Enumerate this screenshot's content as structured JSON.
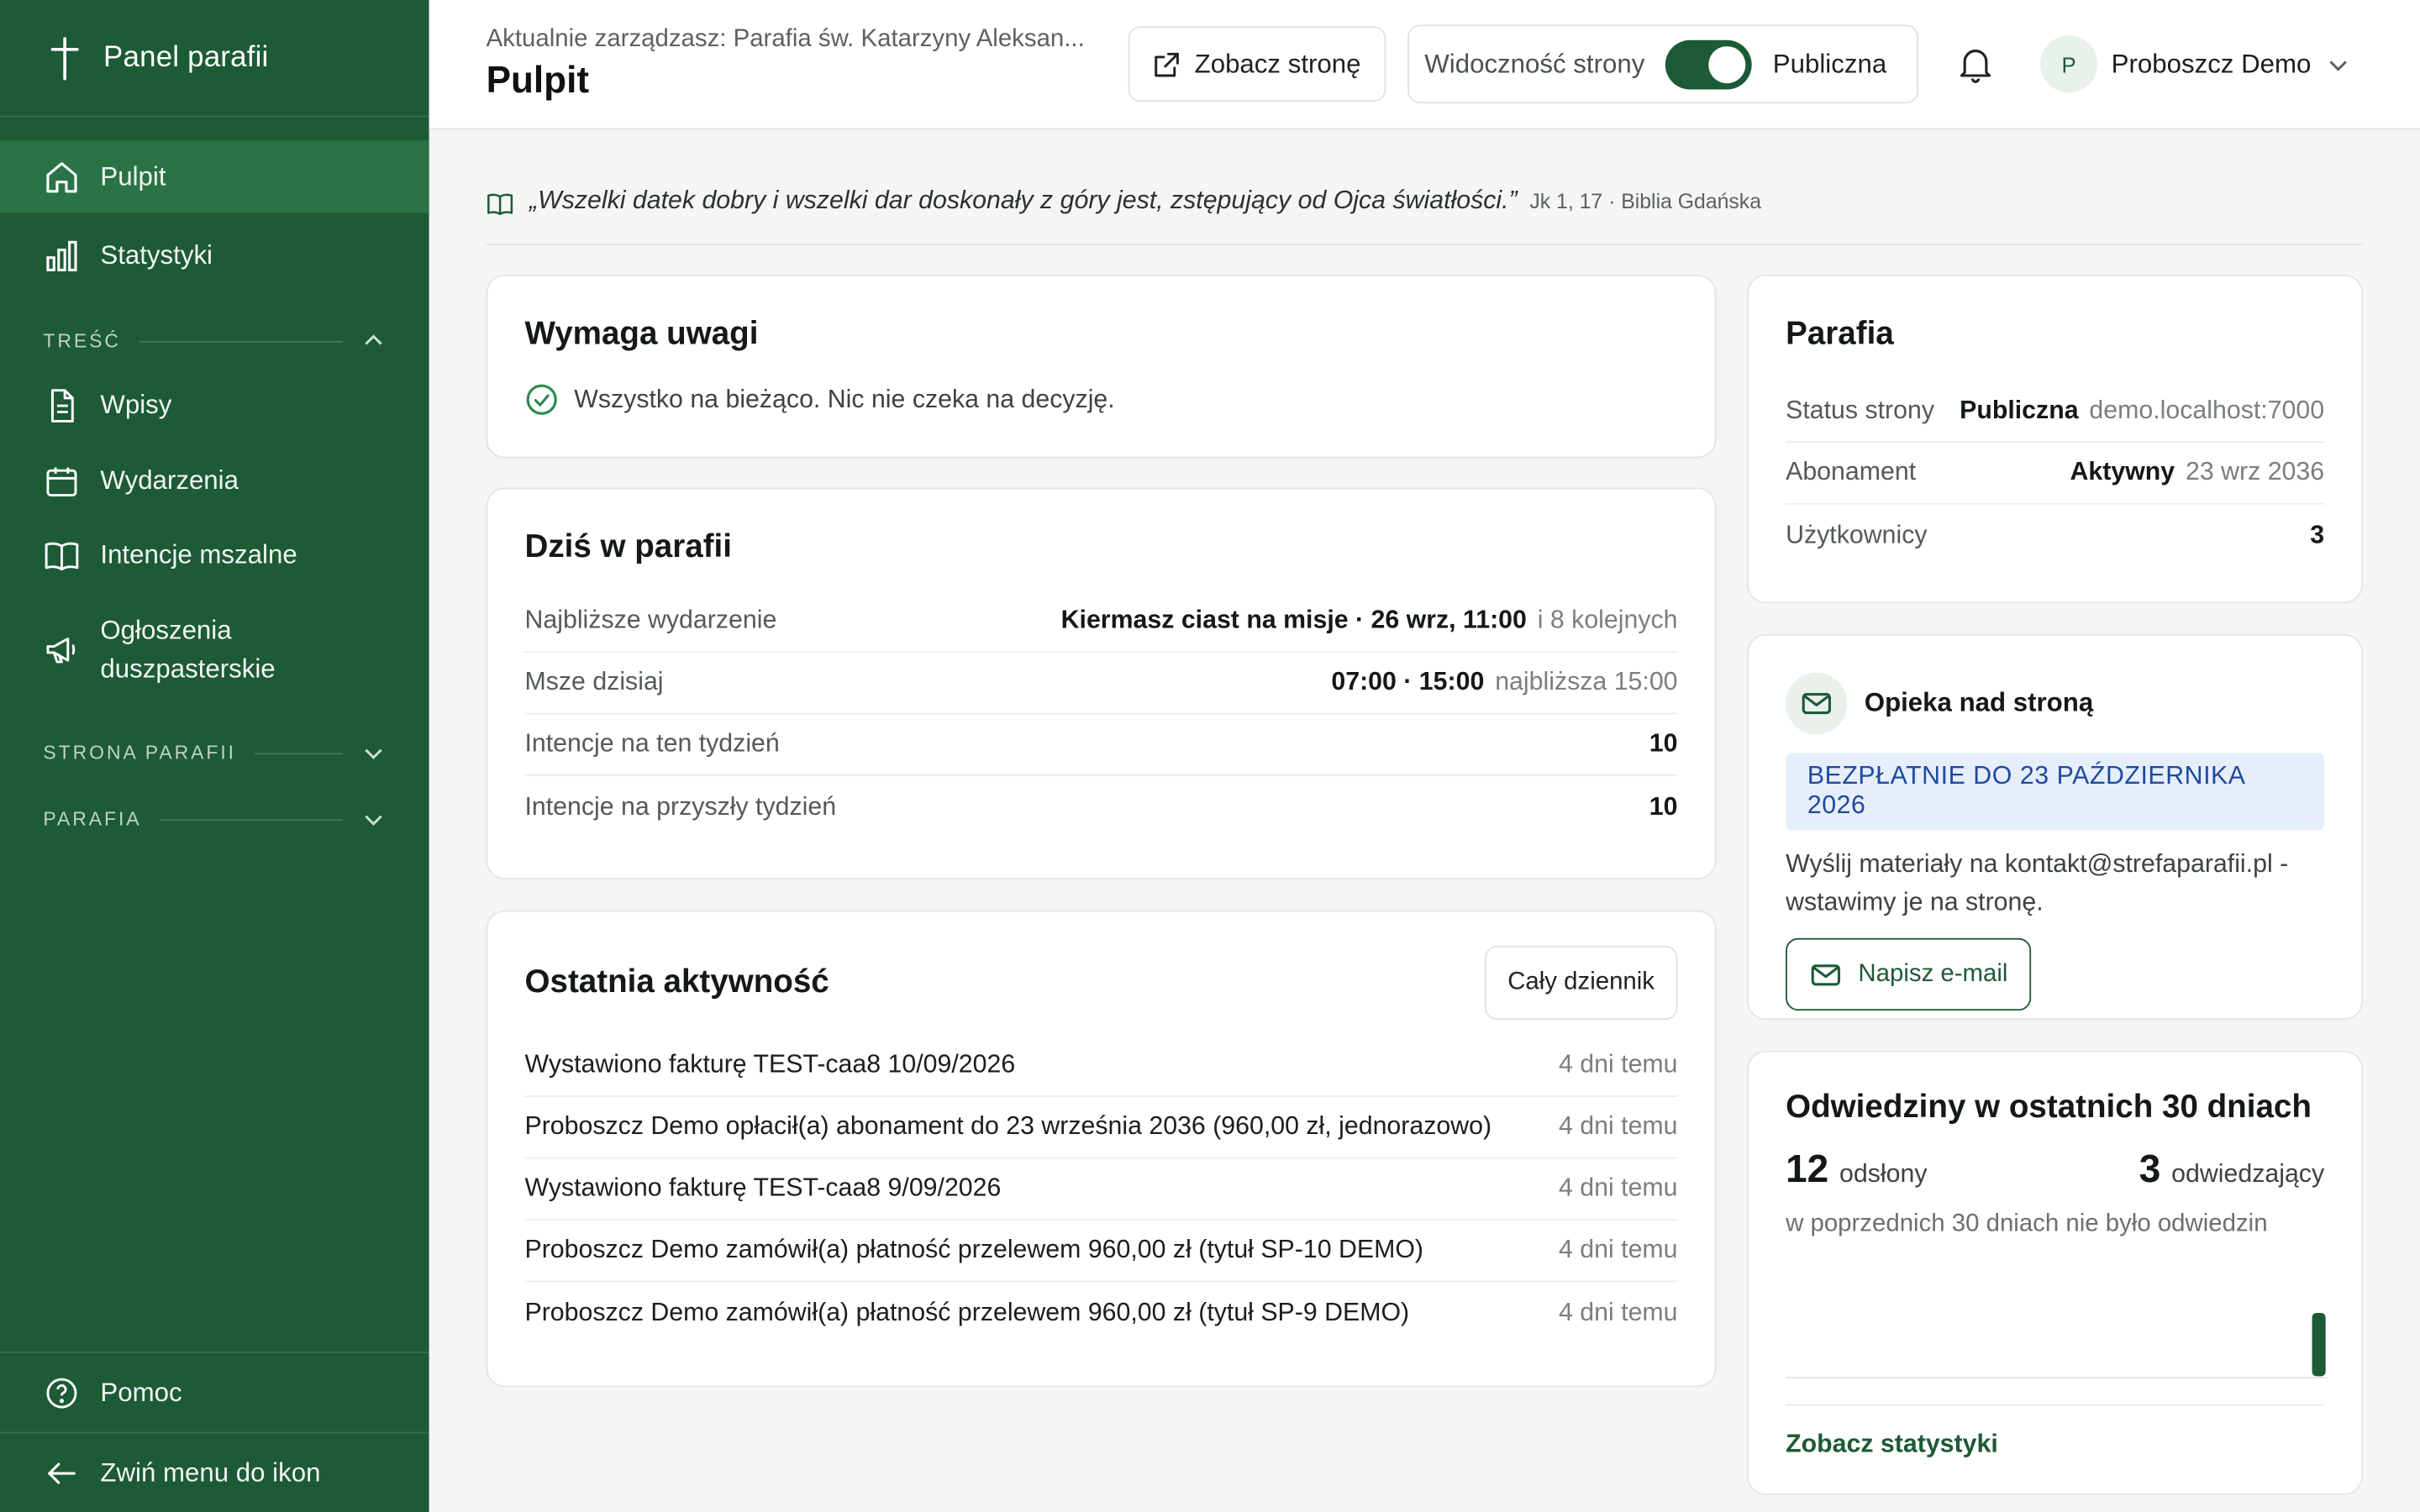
{
  "sidebar": {
    "brand": "Panel parafii",
    "items": [
      {
        "label": "Pulpit",
        "icon": "home-icon",
        "active": true
      },
      {
        "label": "Statystyki",
        "icon": "bar-chart-icon"
      }
    ],
    "section_content": "TREŚĆ",
    "content_items": [
      {
        "label": "Wpisy",
        "icon": "document-icon"
      },
      {
        "label": "Wydarzenia",
        "icon": "calendar-icon"
      },
      {
        "label": "Intencje mszalne",
        "icon": "book-icon"
      },
      {
        "label_line1": "Ogłoszenia",
        "label_line2": "duszpasterskie",
        "icon": "megaphone-icon"
      }
    ],
    "section_site": "STRONA PARAFII",
    "section_parish": "PARAFIA",
    "help": "Pomoc",
    "collapse": "Zwiń menu do ikon"
  },
  "header": {
    "managing": "Aktualnie zarządzasz: Parafia św. Katarzyny Aleksan...",
    "title": "Pulpit",
    "view_site": "Zobacz stronę",
    "visibility_label": "Widoczność strony",
    "visibility_value": "Publiczna",
    "visibility_on": true,
    "user_initial": "P",
    "user_name": "Proboszcz Demo"
  },
  "quote": {
    "text": "„Wszelki datek dobry i wszelki dar doskonały z góry jest, zstępujący od Ojca światłości.”",
    "ref": "Jk 1, 17 · Biblia Gdańska"
  },
  "attention": {
    "title": "Wymaga uwagi",
    "status": "Wszystko na bieżąco. Nic nie czeka na decyzję."
  },
  "today": {
    "title": "Dziś w parafii",
    "rows": [
      {
        "label": "Najbliższe wydarzenie",
        "value": "Kiermasz ciast na misje · 26 wrz, 11:00",
        "extra": "i 8 kolejnych"
      },
      {
        "label": "Msze dzisiaj",
        "value": "07:00 · 15:00",
        "extra": "najbliższa 15:00"
      },
      {
        "label": "Intencje na ten tydzień",
        "value": "10",
        "extra": ""
      },
      {
        "label": "Intencje na przyszły tydzień",
        "value": "10",
        "extra": ""
      }
    ]
  },
  "activity": {
    "title": "Ostatnia aktywność",
    "all_button": "Cały dziennik",
    "rows": [
      {
        "text": "Wystawiono fakturę TEST-caa8 10/09/2026",
        "when": "4 dni temu"
      },
      {
        "text": "Proboszcz Demo opłacił(a) abonament do 23 września 2036 (960,00 zł, jednorazowo)",
        "when": "4 dni temu"
      },
      {
        "text": "Wystawiono fakturę TEST-caa8 9/09/2026",
        "when": "4 dni temu"
      },
      {
        "text": "Proboszcz Demo zamówił(a) płatność przelewem 960,00 zł (tytuł SP-10 DEMO)",
        "when": "4 dni temu"
      },
      {
        "text": "Proboszcz Demo zamówił(a) płatność przelewem 960,00 zł (tytuł SP-9 DEMO)",
        "when": "4 dni temu"
      }
    ]
  },
  "parish": {
    "title": "Parafia",
    "rows": [
      {
        "label": "Status strony",
        "value": "Publiczna",
        "extra": "demo.localhost:7000"
      },
      {
        "label": "Abonament",
        "value": "Aktywny",
        "extra": "23 wrz 2036"
      },
      {
        "label": "Użytkownicy",
        "value": "3",
        "extra": ""
      }
    ]
  },
  "care": {
    "title": "Opieka nad stroną",
    "badge": "BEZPŁATNIE DO 23 PAŹDZIERNIKA 2026",
    "text": "Wyślij materiały na kontakt@strefaparafii.pl - wstawimy je na stronę.",
    "button": "Napisz e-mail"
  },
  "visits": {
    "title": "Odwiedziny w ostatnich 30 dniach",
    "views": "12",
    "views_label": "odsłony",
    "visitors": "3",
    "visitors_label": "odwiedzający",
    "note": "w poprzednich 30 dniach nie było odwiedzin",
    "link": "Zobacz statystyki",
    "daily": [
      0,
      0,
      0,
      0,
      0,
      0,
      0,
      0,
      0,
      0,
      0,
      0,
      0,
      0,
      0,
      0,
      0,
      0,
      0,
      0,
      0,
      0,
      0,
      0,
      0,
      0,
      0,
      0,
      0,
      12
    ]
  },
  "colors": {
    "brand": "#1d5a36",
    "sidebar_active": "#2a7346",
    "badge_bg": "#e7eefb",
    "badge_text": "#1f4aa0"
  }
}
